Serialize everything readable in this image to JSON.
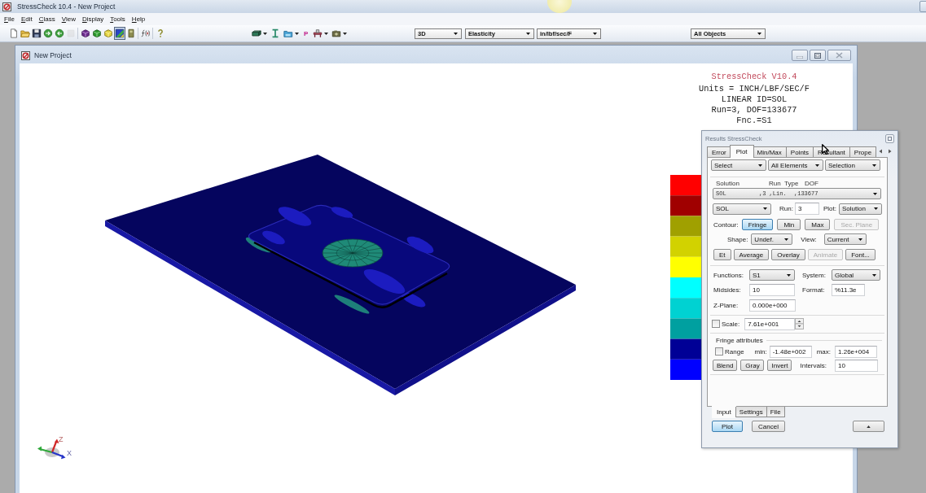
{
  "app": {
    "title": "StressCheck 10.4 - New Project"
  },
  "menu": [
    "File",
    "Edit",
    "Class",
    "View",
    "Display",
    "Tools",
    "Help"
  ],
  "toolbar": {
    "buttons": [
      {
        "pressed": false,
        "disabled": false
      },
      {
        "pressed": false,
        "disabled": false
      },
      {
        "pressed": false,
        "disabled": false
      },
      {
        "pressed": false,
        "disabled": false
      },
      {
        "pressed": false,
        "disabled": false
      },
      {
        "pressed": false,
        "disabled": true
      },
      {
        "pressed": false,
        "disabled": false
      },
      {
        "pressed": false,
        "disabled": false
      },
      {
        "pressed": false,
        "disabled": false
      },
      {
        "pressed": true,
        "disabled": false
      },
      {
        "pressed": false,
        "disabled": false
      },
      {
        "pressed": false,
        "disabled": false
      },
      {
        "pressed": false,
        "disabled": false
      }
    ],
    "p_label": "P",
    "selects": [
      "3D",
      "Elasticity",
      "in/lbf/sec/F",
      "All Objects"
    ]
  },
  "document": {
    "title": "New Project",
    "info_title": "StressCheck V10.4",
    "info_lines": [
      "Units = INCH/LBF/SEC/F",
      "LINEAR ID=SOL",
      "Run=3, DOF=133677",
      "Fnc.=S1"
    ],
    "legend": [
      {
        "color": "#ff0000"
      },
      {
        "color": "#a00000"
      },
      {
        "color": "#a0a000"
      },
      {
        "color": "#d2d200"
      },
      {
        "color": "#ffff00"
      },
      {
        "color": "#00ffff"
      },
      {
        "color": "#00d2d2"
      },
      {
        "color": "#00a0a0"
      },
      {
        "color": "#000096"
      },
      {
        "color": "#0000ff"
      }
    ],
    "axes": {
      "z": "Z",
      "x": "X"
    }
  },
  "results": {
    "title": "Results StressCheck",
    "tabs": [
      {
        "label": "Error",
        "selected": false
      },
      {
        "label": "Plot",
        "selected": true
      },
      {
        "label": "Min/Max",
        "selected": false
      },
      {
        "label": "Points",
        "selected": false
      },
      {
        "label": "Resultant",
        "selected": false
      },
      {
        "label": "Prope",
        "selected": false
      }
    ],
    "selectors": [
      "Select",
      "All Elements",
      "Selection"
    ],
    "solution_headers": [
      "Solution",
      "Run",
      "Type",
      "DOF"
    ],
    "solution_values": [
      "SOL",
      ",3 ,Lin.",
      ",133677"
    ],
    "solution_id": "SOL",
    "run_label": "Run:",
    "run": "3",
    "plot_label": "Plot:",
    "plot": "Solution",
    "contour_label": "Contour:",
    "contour_buttons": [
      {
        "label": "Fringe",
        "selected": true,
        "disabled": false
      },
      {
        "label": "Min",
        "selected": false,
        "disabled": false
      },
      {
        "label": "Max",
        "selected": false,
        "disabled": false
      },
      {
        "label": "Sec. Plane",
        "selected": false,
        "disabled": true
      }
    ],
    "shape_label": "Shape:",
    "shape": "Undef.",
    "view_label": "View:",
    "view": "Current",
    "actions": [
      {
        "label": "Et",
        "disabled": false
      },
      {
        "label": "Average",
        "disabled": false
      },
      {
        "label": "Overlay",
        "disabled": false
      },
      {
        "label": "Animate",
        "disabled": true
      },
      {
        "label": "Font...",
        "disabled": false
      }
    ],
    "functions_label": "Functions:",
    "function": "S1",
    "system_label": "System:",
    "system": "Global",
    "midsides_label": "Midsides:",
    "midsides": "10",
    "format_label": "Format:",
    "format": "%11.3e",
    "zplane_label": "Z-Plane:",
    "zplane": "0.000e+000",
    "scale": {
      "label": "Scale:",
      "checked": false,
      "value": "7.61e+001"
    },
    "fringe": {
      "title": "Fringe attributes",
      "range_label": "Range",
      "range_checked": false,
      "min_label": "min:",
      "min": "-1.48e+002",
      "max_label": "max:",
      "max": "1.26e+004",
      "buttons": [
        "Blend",
        "Gray",
        "Invert"
      ],
      "intervals_label": "Intervals:",
      "intervals": "10"
    },
    "bottom_tabs": [
      {
        "label": "Input",
        "selected": true
      },
      {
        "label": "Settings",
        "selected": false
      },
      {
        "label": "File",
        "selected": false
      }
    ],
    "buttons": [
      {
        "label": "Plot",
        "focused": true
      },
      {
        "label": "Cancel",
        "focused": false
      }
    ]
  }
}
